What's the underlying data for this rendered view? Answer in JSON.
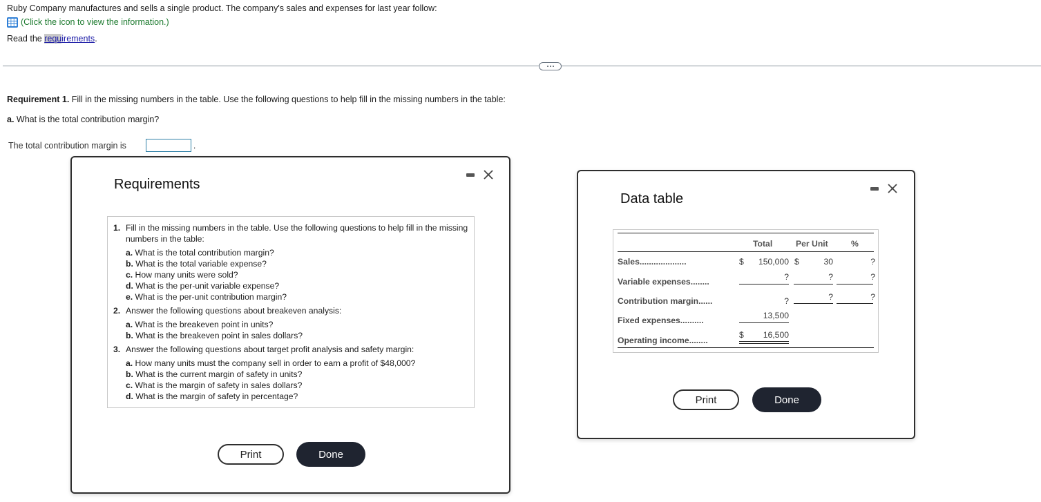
{
  "intro": {
    "line1": "Ruby Company manufactures and sells a single product. The company's sales and expenses for last year follow:",
    "click_icon_name": "data-table-grid-icon",
    "click_text": "(Click the icon to view the information.)",
    "read_prefix": "Read the ",
    "req_link_highlight": "requ",
    "req_link_rest": "irements",
    "read_suffix": "."
  },
  "requirement1": {
    "bold": "Requirement 1.",
    "text": " Fill in the missing numbers in the table. Use the following questions to help fill in the missing numbers in the table:"
  },
  "question_a": {
    "bold": "a.",
    "text": " What is the total contribution margin?"
  },
  "answer": {
    "label": "The total contribution margin is",
    "value": "",
    "suffix": "."
  },
  "requirements_modal": {
    "title": "Requirements",
    "items": [
      {
        "num": "1.",
        "text": "Fill in the missing numbers in the table. Use the following questions to help fill in the missing numbers in the table:",
        "subs": [
          {
            "letter": "a.",
            "text": " What is the total contribution margin?"
          },
          {
            "letter": "b.",
            "text": " What is the total variable expense?"
          },
          {
            "letter": "c.",
            "text": " How many units were sold?"
          },
          {
            "letter": "d.",
            "text": " What is the per-unit variable expense?"
          },
          {
            "letter": "e.",
            "text": " What is the per-unit contribution margin?"
          }
        ]
      },
      {
        "num": "2.",
        "text": "Answer the following questions about breakeven analysis:",
        "subs": [
          {
            "letter": "a.",
            "text": " What is the breakeven point in units?"
          },
          {
            "letter": "b.",
            "text": " What is the breakeven point in sales dollars?"
          }
        ]
      },
      {
        "num": "3.",
        "text": "Answer the following questions about target profit analysis and safety margin:",
        "subs": [
          {
            "letter": "a.",
            "text": " How many units must the company sell in order to earn a profit of $48,000?"
          },
          {
            "letter": "b.",
            "text": " What is the current margin of safety in units?"
          },
          {
            "letter": "c.",
            "text": " What is the margin of safety in sales dollars?"
          },
          {
            "letter": "d.",
            "text": " What is the margin of safety in percentage?"
          }
        ]
      }
    ],
    "print_label": "Print",
    "done_label": "Done"
  },
  "data_modal": {
    "title": "Data table",
    "headers": {
      "total": "Total",
      "per_unit": "Per Unit",
      "percent": "%"
    },
    "rows": [
      {
        "label": "Sales",
        "dots": "....................",
        "dollar_total": "$",
        "total": "150,000",
        "dollar_unit": "$",
        "per_unit": "30",
        "percent": "?"
      },
      {
        "label": "Variable expenses",
        "dots": "........",
        "total": "?",
        "per_unit": "?",
        "percent": "?"
      },
      {
        "label": "Contribution margin",
        "dots": "......",
        "total": "?",
        "per_unit": "?",
        "percent": "?"
      },
      {
        "label": "Fixed expenses",
        "dots": "..........",
        "total": "13,500"
      },
      {
        "label": "Operating income",
        "dots": "........",
        "dollar_total": "$",
        "total": "16,500"
      }
    ],
    "print_label": "Print",
    "done_label": "Done"
  }
}
